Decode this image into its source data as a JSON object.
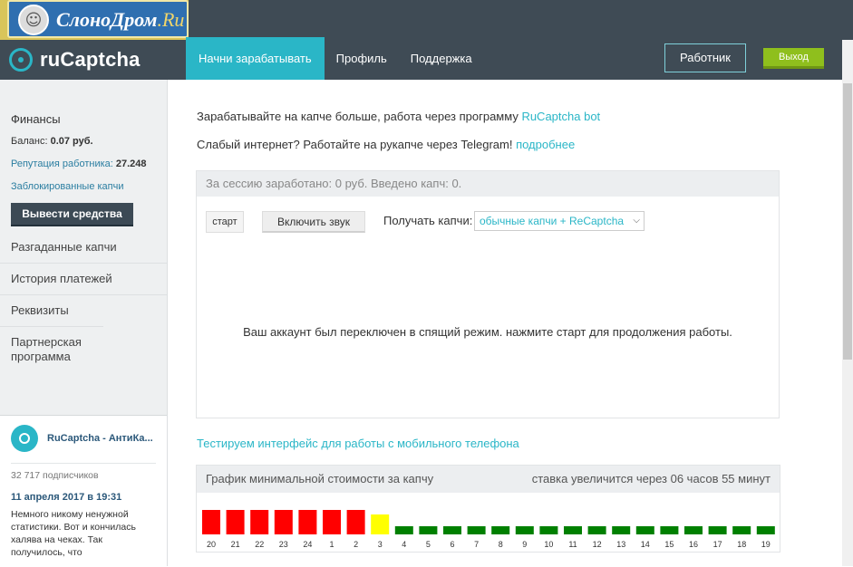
{
  "overlay_logo": {
    "title": "СлоноДром",
    "suffix": ".Ru"
  },
  "header": {
    "brand": "ruCaptcha",
    "nav": [
      {
        "label": "Начни зарабатывать",
        "active": true
      },
      {
        "label": "Профиль",
        "active": false
      },
      {
        "label": "Поддержка",
        "active": false
      }
    ],
    "worker_button": "Работник",
    "exit_button": "Выход"
  },
  "sidebar": {
    "section_title": "Финансы",
    "balance_label": "Баланс:",
    "balance_value": "0.07 руб.",
    "reputation_label": "Репутация работника:",
    "reputation_value": "27.248",
    "blocked_link": "Заблокированные капчи",
    "withdraw_button": "Вывести средства",
    "menu": [
      "Разгаданные капчи",
      "История платежей",
      "Реквизиты",
      "Партнерская программа"
    ]
  },
  "vk_widget": {
    "name": "RuCaptcha - АнтиКа...",
    "subscribers": "32 717 подписчиков",
    "date": "11 апреля 2017 в 19:31",
    "text": "Немного никому ненужной статистики. Вот и кончилась халява на чеках. Так получилось, что"
  },
  "main": {
    "intro1_text": "Зарабатывайте на капче больше, работа через программу ",
    "intro1_link": "RuCaptcha bot",
    "intro2_text": "Слабый интернет? Работайте на рукапче через Telegram! ",
    "intro2_link": "подробнее",
    "session_summary": "За сессию заработано: 0 руб. Введено капч: 0.",
    "start_button": "старт",
    "sound_button": "Включить звук",
    "receive_label": "Получать капчи:",
    "receive_selected": "обычные капчи + ReCaptcha",
    "sleep_message": "Ваш аккаунт был переключен в спящий режим. нажмите старт для продолжения работы.",
    "mobile_link": "Тестируем интерфейс для работы с мобильного телефона"
  },
  "chart_data": {
    "type": "bar",
    "title": "График минимальной стоимости за капчу",
    "note": "ставка увеличится через 06 часов 55 минут",
    "categories": [
      "20",
      "21",
      "22",
      "23",
      "24",
      "1",
      "2",
      "3",
      "4",
      "5",
      "6",
      "7",
      "8",
      "9",
      "10",
      "11",
      "12",
      "13",
      "14",
      "15",
      "16",
      "17",
      "18",
      "19"
    ],
    "levels": [
      "high",
      "high",
      "high",
      "high",
      "high",
      "high",
      "high",
      "medium",
      "low",
      "low",
      "low",
      "low",
      "low",
      "low",
      "low",
      "low",
      "low",
      "low",
      "low",
      "low",
      "low",
      "low",
      "low",
      "low"
    ],
    "level_colors": {
      "high": "#ff0000",
      "medium": "#ffff00",
      "low": "#008000"
    }
  },
  "colors": {
    "accent": "#2ab6c7",
    "header_bg": "#3f4b55",
    "exit": "#8fbf1d"
  },
  "icons": {
    "brand": "lock-icon",
    "vk": "lock-icon"
  }
}
